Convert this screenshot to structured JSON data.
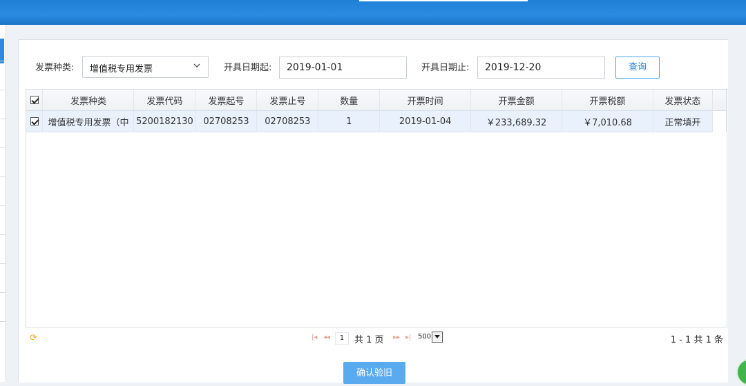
{
  "filters": {
    "invoice_type_label": "发票种类:",
    "invoice_type_value": "增值税专用发票",
    "date_start_label": "开具日期起:",
    "date_start_value": "2019-01-01",
    "date_end_label": "开具日期止:",
    "date_end_value": "2019-12-20",
    "query_button": "查询"
  },
  "grid": {
    "columns": [
      "发票种类",
      "发票代码",
      "发票起号",
      "发票止号",
      "数量",
      "开票时间",
      "开票金额",
      "开票税额",
      "发票状态"
    ],
    "select_all_checked": true,
    "rows": [
      {
        "checked": true,
        "type": "增值税专用发票（中",
        "code": "5200182130",
        "start_no": "02708253",
        "end_no": "02708253",
        "qty": "1",
        "date": "2019-01-04",
        "amount": "￥233,689.32",
        "tax": "￥7,010.68",
        "status": "正常填开"
      }
    ]
  },
  "pager": {
    "page_value": "1",
    "total_pages": "共 1 页",
    "page_size": "500",
    "range_text": "1 - 1   共 1 条"
  },
  "actions": {
    "confirm_label": "确认验旧"
  },
  "icons": {
    "refresh": "refresh-icon",
    "first": "first-page-icon",
    "prev": "prev-page-icon",
    "next": "next-page-icon",
    "last": "last-page-icon",
    "chevron": "chevron-down-icon"
  },
  "colors": {
    "header_blue": "#1f80d6",
    "primary_button": "#5aaaf0",
    "selected_row": "#e8f1fc"
  }
}
